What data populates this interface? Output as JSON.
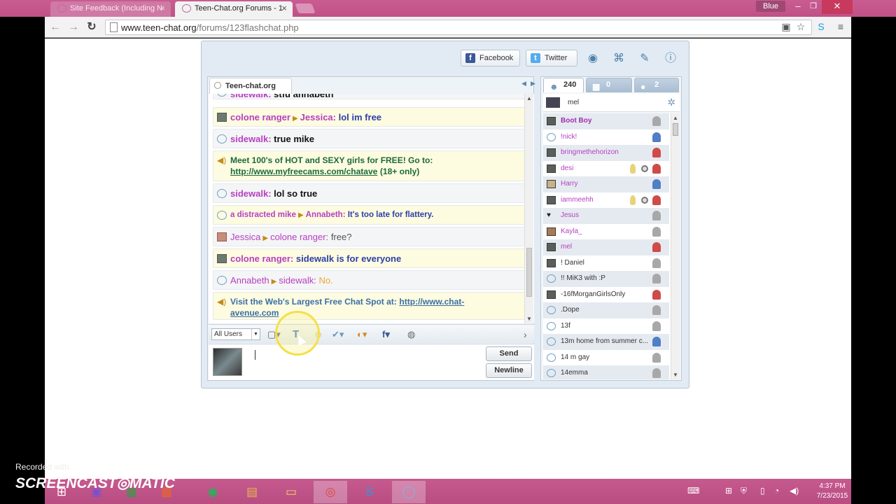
{
  "browser": {
    "tabs": [
      {
        "title": "Site Feedback (Including N"
      },
      {
        "title": "Teen-Chat.org Forums - 1"
      }
    ],
    "user_badge": "Blue",
    "url_domain": "www.teen-chat.org",
    "url_path": "/forums/123flashchat.php"
  },
  "chat": {
    "header_buttons": {
      "facebook": "Facebook",
      "twitter": "Twitter"
    },
    "room_tab": "Teen-chat.org",
    "cut_message": {
      "user": "sidewalk:",
      "text": "stfu annabeth"
    },
    "messages": [
      {
        "user": "colone ranger",
        "to": "Jessica:",
        "text": "lol im free"
      },
      {
        "user": "sidewalk:",
        "text": "true mike"
      },
      {
        "system_text": "Meet 100's of HOT and SEXY girls for FREE!  Go to:",
        "link": "http://www.myfreecams.com/chatave",
        "tail": "(18+ only)"
      },
      {
        "user": "sidewalk:",
        "text": "lol so true"
      },
      {
        "user": "a distracted mike",
        "to": "Annabeth:",
        "text": "It's too late for flattery."
      },
      {
        "user": "Jessica",
        "to": "colone ranger:",
        "text": "free?"
      },
      {
        "user": "colone ranger:",
        "text": "sidewalk is for everyone"
      },
      {
        "user": "Annabeth",
        "to": "sidewalk:",
        "text": "No."
      },
      {
        "system_text": "Visit the Web's Largest Free Chat Spot at:",
        "link": "http://www.chat-avenue.com"
      }
    ],
    "compose": {
      "user_select": "All Users",
      "send": "Send",
      "newline": "Newline"
    }
  },
  "users_panel": {
    "tabs": {
      "online": "240",
      "rooms": "0",
      "messages": "2"
    },
    "me": "mel",
    "users": [
      {
        "name": "Boot Boy"
      },
      {
        "name": "!nick!"
      },
      {
        "name": "bringmethehorizon"
      },
      {
        "name": "desi"
      },
      {
        "name": "Harry"
      },
      {
        "name": "iammeehh"
      },
      {
        "name": "Jesus"
      },
      {
        "name": "Kayla_"
      },
      {
        "name": "mel"
      },
      {
        "name": "! Daniel"
      },
      {
        "name": "!! MiK3 with :P"
      },
      {
        "name": "-16fMorganGirlsOnly"
      },
      {
        "name": ".Dope"
      },
      {
        "name": "13f"
      },
      {
        "name": "13m home from summer c..."
      },
      {
        "name": "14 m gay"
      },
      {
        "name": "14emma"
      }
    ]
  },
  "watermark": {
    "recorded": "Recorded with",
    "brand": "SCREENCAST◎MATIC"
  },
  "taskbar": {
    "time": "4:37 PM",
    "date": "7/23/2015"
  }
}
